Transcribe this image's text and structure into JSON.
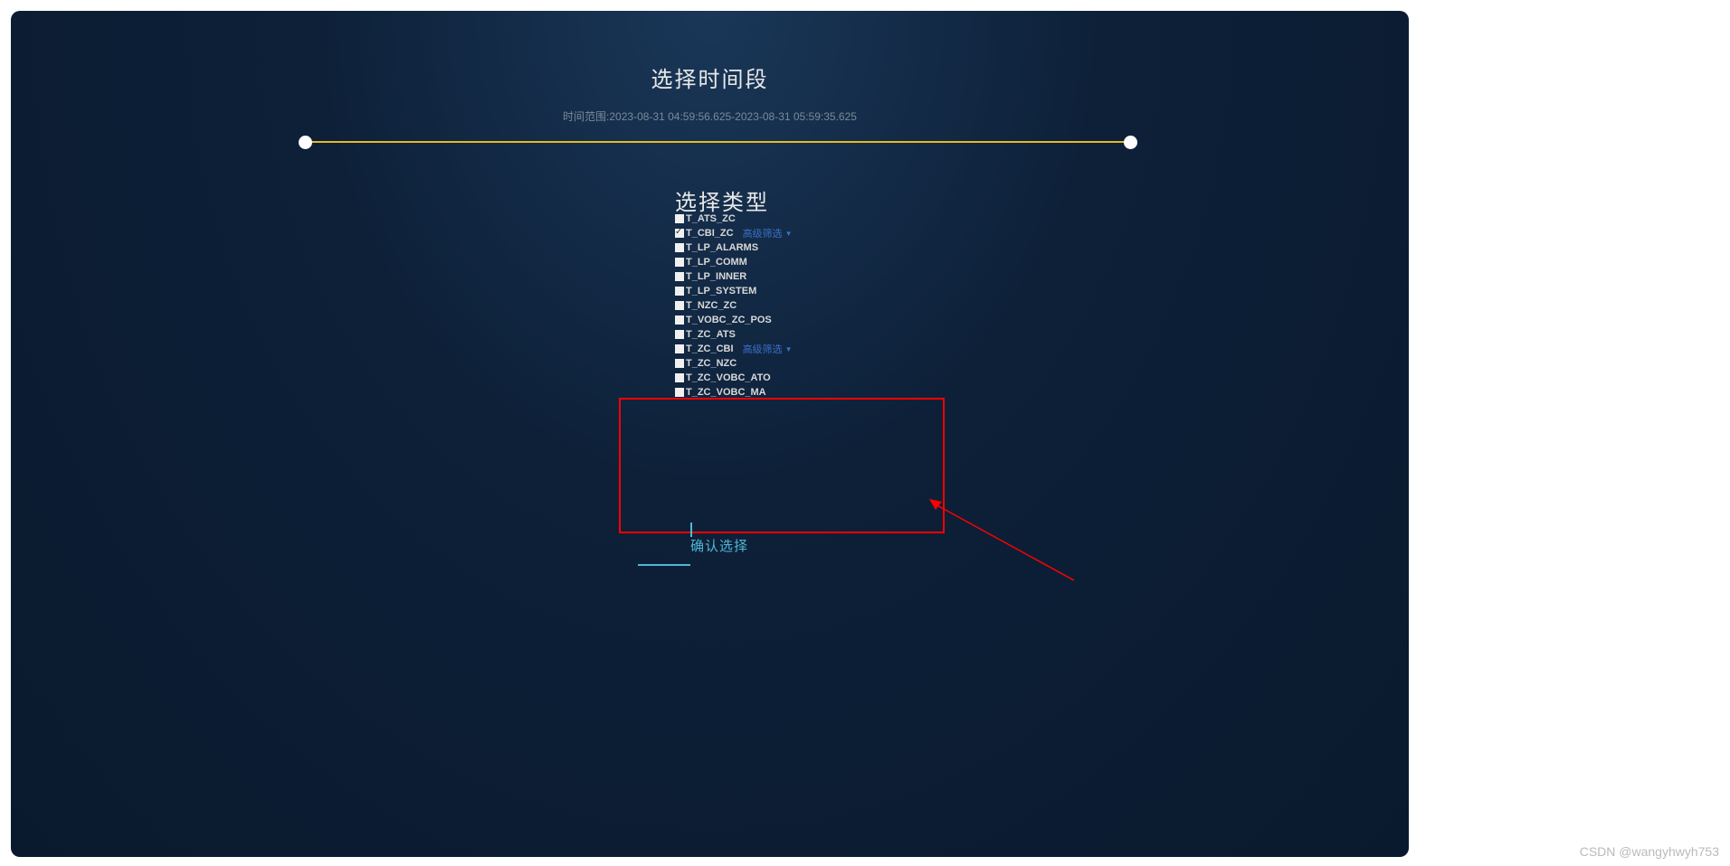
{
  "header": {
    "title": "选择时间段",
    "time_range_text": "时间范围:2023-08-31 04:59:56.625-2023-08-31 05:59:35.625"
  },
  "type_section": {
    "title": "选择类型",
    "advanced_filter_label": "高级筛选",
    "items": [
      {
        "label": "T_ATS_ZC",
        "checked": false,
        "has_filter": false
      },
      {
        "label": "T_CBI_ZC",
        "checked": true,
        "has_filter": true
      },
      {
        "label": "T_LP_ALARMS",
        "checked": false,
        "has_filter": false
      },
      {
        "label": "T_LP_COMM",
        "checked": false,
        "has_filter": false
      },
      {
        "label": "T_LP_INNER",
        "checked": false,
        "has_filter": false
      },
      {
        "label": "T_LP_SYSTEM",
        "checked": false,
        "has_filter": false
      },
      {
        "label": "T_NZC_ZC",
        "checked": false,
        "has_filter": false
      },
      {
        "label": "T_VOBC_ZC_POS",
        "checked": false,
        "has_filter": false
      },
      {
        "label": "T_ZC_ATS",
        "checked": false,
        "has_filter": false
      },
      {
        "label": "T_ZC_CBI",
        "checked": false,
        "has_filter": true
      },
      {
        "label": "T_ZC_NZC",
        "checked": false,
        "has_filter": false
      },
      {
        "label": "T_ZC_VOBC_ATO",
        "checked": false,
        "has_filter": false
      },
      {
        "label": "T_ZC_VOBC_MA",
        "checked": false,
        "has_filter": false
      }
    ]
  },
  "confirm": {
    "label": "确认选择"
  },
  "watermark": "CSDN @wangyhwyh753"
}
